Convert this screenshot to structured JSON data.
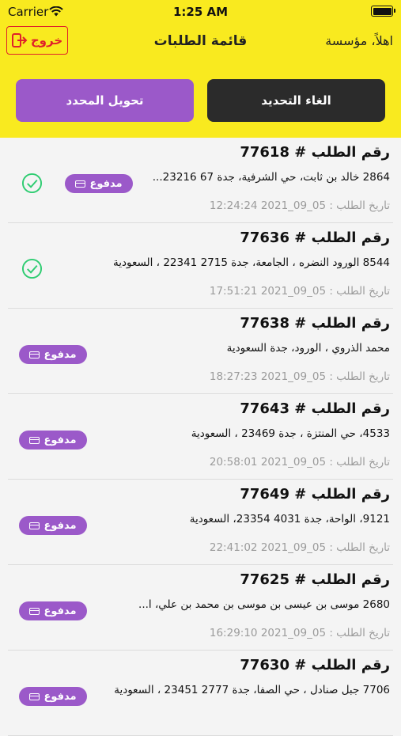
{
  "status_bar": {
    "carrier": "Carrier",
    "time": "1:25 AM"
  },
  "header": {
    "logout_label": "خروج",
    "title": "قائمة الطلبات",
    "greeting": "اهلاً، مؤسسة"
  },
  "actions": {
    "cancel_selection": "الغاء التحديد",
    "convert_selected": "تحويل المحدد"
  },
  "colors": {
    "header_bg": "#f9ea1f",
    "accent_purple": "#9b59c9",
    "dark_button": "#2b2b2b",
    "logout_red": "#e0212a",
    "check_green": "#2ecc71"
  },
  "orders": [
    {
      "number": "رقم الطلب # 77618",
      "address": "2864 خالد بن ثابت، حي الشرفية، جدة 67 23216...",
      "date": "تاريخ الطلب : 05_09_2021 12:24:24",
      "badge": "مدفوع",
      "selected": true
    },
    {
      "number": "رقم الطلب # 77636",
      "address": "8544 الورود النضره ، الجامعة، جدة 2715 22341 ، السعودية",
      "date": "تاريخ الطلب : 05_09_2021 17:51:21",
      "badge": "",
      "selected": true
    },
    {
      "number": "رقم الطلب # 77638",
      "address": "محمد الذروي ، الورود، جدة السعودية",
      "date": "تاريخ الطلب : 05_09_2021 18:27:23",
      "badge": "مدفوع",
      "selected": false
    },
    {
      "number": "رقم الطلب # 77643",
      "address": "4533، حي المنتزة ، جدة 23469 ، السعودية",
      "date": "تاريخ الطلب : 05_09_2021 20:58:01",
      "badge": "مدفوع",
      "selected": false
    },
    {
      "number": "رقم الطلب # 77649",
      "address": "9121، الواحة، جدة 4031 23354، السعودية",
      "date": "تاريخ الطلب : 05_09_2021 22:41:02",
      "badge": "مدفوع",
      "selected": false
    },
    {
      "number": "رقم الطلب # 77625",
      "address": "2680 موسى بن عيسى بن موسى بن محمد بن علي، ا...",
      "date": "تاريخ الطلب : 05_09_2021 16:29:10",
      "badge": "مدفوع",
      "selected": false
    },
    {
      "number": "رقم الطلب # 77630",
      "address": "7706 جبل صنادل ، حي الصفا، جدة 2777 23451 ، السعودية",
      "date": "",
      "badge": "مدفوع",
      "selected": false
    }
  ]
}
